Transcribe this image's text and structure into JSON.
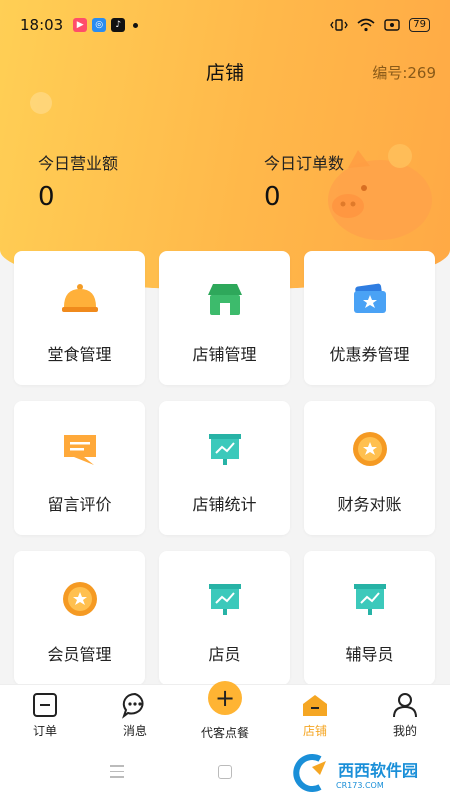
{
  "status_bar": {
    "time": "18:03",
    "battery": "79"
  },
  "header": {
    "title": "店铺",
    "shop_number": "编号:269"
  },
  "stats": {
    "revenue_label": "今日营业额",
    "revenue_value": "0",
    "orders_label": "今日订单数",
    "orders_value": "0"
  },
  "grid": [
    {
      "label": "堂食管理",
      "icon": "dine-in-cloche-icon"
    },
    {
      "label": "店铺管理",
      "icon": "store-icon"
    },
    {
      "label": "优惠券管理",
      "icon": "coupon-icon"
    },
    {
      "label": "留言评价",
      "icon": "message-review-icon"
    },
    {
      "label": "店铺统计",
      "icon": "statistics-board-icon"
    },
    {
      "label": "财务对账",
      "icon": "finance-coin-icon"
    },
    {
      "label": "会员管理",
      "icon": "member-star-coin-icon"
    },
    {
      "label": "店员",
      "icon": "staff-board-icon"
    },
    {
      "label": "辅导员",
      "icon": "tutor-board-icon"
    }
  ],
  "tabs": [
    {
      "label": "订单",
      "icon": "order-icon",
      "active": false
    },
    {
      "label": "消息",
      "icon": "message-icon",
      "active": false
    },
    {
      "label": "代客点餐",
      "icon": "plus-icon",
      "active": false
    },
    {
      "label": "店铺",
      "icon": "store-tab-icon",
      "active": true
    },
    {
      "label": "我的",
      "icon": "profile-icon",
      "active": false
    }
  ],
  "watermark": {
    "text": "西西软件园",
    "sub": "CR173.COM"
  },
  "colors": {
    "accent": "#f5a623",
    "header_gradient_start": "#ffcf55",
    "header_gradient_end": "#ffa945"
  }
}
